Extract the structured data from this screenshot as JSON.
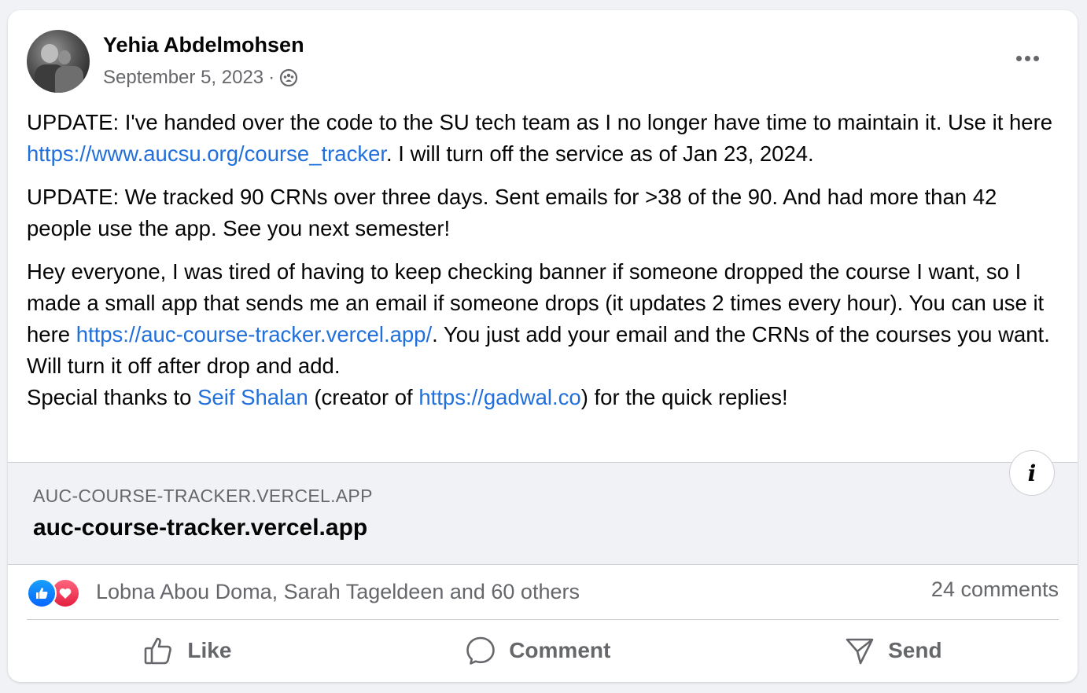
{
  "post": {
    "author": "Yehia Abdelmohsen",
    "date": "September 5, 2023",
    "separator": "·",
    "audience_icon": "friends-icon",
    "paragraphs": {
      "p1_a": "UPDATE: I've handed over the code to the SU tech team as I no longer have time to maintain it. Use it here ",
      "p1_link": "https://www.aucsu.org/course_tracker",
      "p1_b": ". I will turn off the service as of Jan 23, 2024.",
      "p2": "UPDATE: We tracked 90 CRNs over three days. Sent emails for >38 of the 90. And had more than 42 people use the app. See you next semester!",
      "p3_a": "Hey everyone, I was tired of having to keep checking banner if someone dropped the course I want, so I made a small app that sends me an email if someone drops (it updates 2 times every hour). You can use it here ",
      "p3_link": "https://auc-course-tracker.vercel.app/",
      "p3_b": ". You just add your email and the CRNs of the courses you want. Will turn it off after drop and add.",
      "p4_a": "Special thanks to ",
      "p4_mention": "Seif Shalan",
      "p4_b": " (creator of ",
      "p4_link": "https://gadwal.co",
      "p4_c": ") for the quick replies!"
    }
  },
  "link_preview": {
    "domain": "AUC-COURSE-TRACKER.VERCEL.APP",
    "title": "auc-course-tracker.vercel.app",
    "info_label": "i"
  },
  "engagement": {
    "reactors": "Lobna Abou Doma, Sarah Tageldeen and 60 others",
    "comments": "24 comments"
  },
  "actions": {
    "like": "Like",
    "comment": "Comment",
    "send": "Send"
  },
  "colors": {
    "link": "#216fdb",
    "secondary_text": "#65676b",
    "like_blue": "#0866ff",
    "love_red": "#e41e3f"
  }
}
